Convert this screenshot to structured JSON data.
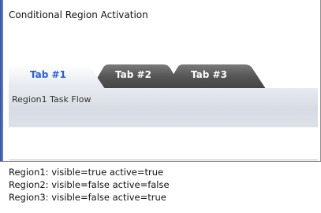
{
  "page": {
    "title": "Conditional Region Activation"
  },
  "tabs": [
    {
      "label": "Tab #1",
      "active": true
    },
    {
      "label": "Tab #2",
      "active": false
    },
    {
      "label": "Tab #3",
      "active": false
    }
  ],
  "region": {
    "content": "Region1 Task Flow"
  },
  "status": [
    "Region1: visible=true active=true",
    "Region2: visible=false active=false",
    "Region3: visible=false active=true"
  ],
  "colors": {
    "active_tab_text": "#2a5fd2",
    "inactive_tab_fill": "#5b5b5b",
    "tabbar_bg": "#dde1e8",
    "frame_accent": "#2f4ea8"
  }
}
